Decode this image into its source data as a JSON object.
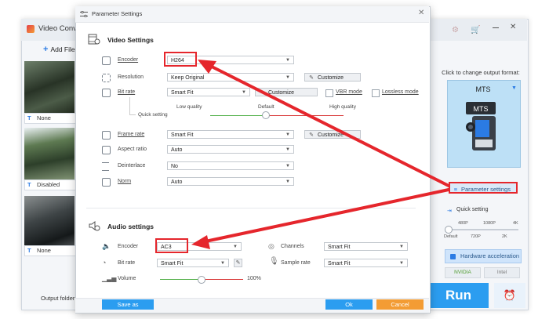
{
  "background_app": {
    "title": "Video Conv",
    "add_files_label": "Add File",
    "clips": [
      {
        "subtitle": "None"
      },
      {
        "subtitle": "Disabled"
      },
      {
        "subtitle": "None"
      }
    ],
    "output_folder_label": "Output folder:",
    "output_panel": {
      "prompt": "Click to change output format:",
      "format": "MTS",
      "format_label_on_image": "MTS",
      "parameter_settings_label": "Parameter settings",
      "quick_setting_label": "Quick setting",
      "quality_ticks_top": [
        "480P",
        "1080P",
        "4K"
      ],
      "quality_ticks_bottom": [
        "Default",
        "720P",
        "2K"
      ],
      "hardware_acceleration_label": "Hardware acceleration",
      "nvidia_label": "NVIDIA",
      "intel_label": "Intel",
      "run_label": "Run"
    }
  },
  "dialog": {
    "title": "Parameter Settings",
    "video": {
      "section_title": "Video Settings",
      "encoder": {
        "label": "Encoder",
        "value": "H264"
      },
      "resolution": {
        "label": "Resolution",
        "value": "Keep Original",
        "button": "Customize"
      },
      "bit_rate": {
        "label": "Bit rate",
        "value": "Smart Fit",
        "button": "Customize"
      },
      "vbr_mode_label": "VBR mode",
      "lossless_mode_label": "Lossless mode",
      "quality": {
        "low": "Low quality",
        "default": "Default",
        "high": "High quality"
      },
      "quick_setting_label": "Quick setting",
      "frame_rate": {
        "label": "Frame rate",
        "value": "Smart Fit",
        "button": "Customize"
      },
      "aspect_ratio": {
        "label": "Aspect ratio",
        "value": "Auto"
      },
      "deinterlace": {
        "label": "Deinterlace",
        "value": "No"
      },
      "norm": {
        "label": "Norm",
        "value": "Auto"
      }
    },
    "audio": {
      "section_title": "Audio settings",
      "encoder": {
        "label": "Encoder",
        "value": "AC3"
      },
      "channels": {
        "label": "Channels",
        "value": "Smart Fit"
      },
      "bit_rate": {
        "label": "Bit rate",
        "value": "Smart Fit"
      },
      "sample_rate": {
        "label": "Sample rate",
        "value": "Smart Fit"
      },
      "volume": {
        "label": "Volume",
        "value": "100%"
      }
    },
    "buttons": {
      "save_as": "Save as",
      "ok": "Ok",
      "cancel": "Cancel"
    }
  },
  "colors": {
    "accent": "#2b9df0",
    "highlight_red": "#e5262c",
    "cancel_orange": "#f39c34",
    "format_box": "#bde0f6"
  }
}
